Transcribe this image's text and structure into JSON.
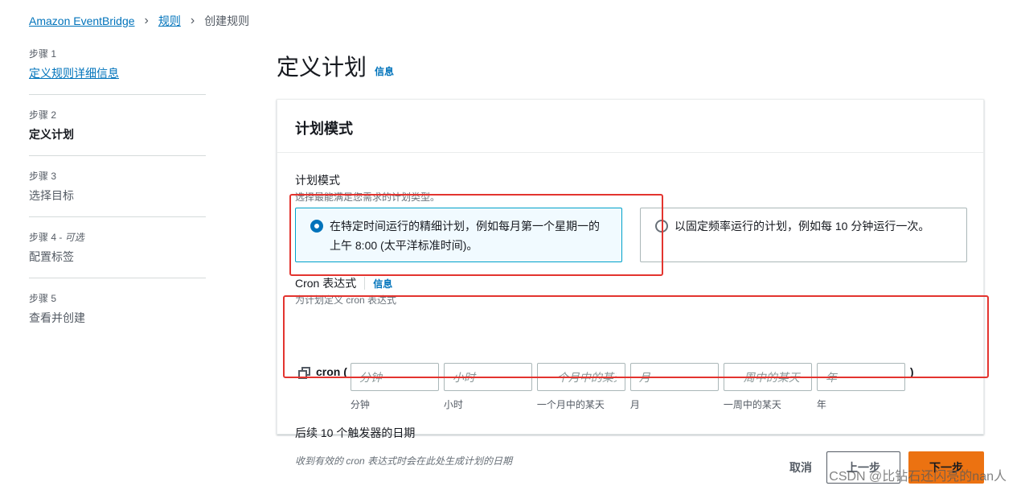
{
  "breadcrumb": {
    "items": [
      "Amazon EventBridge",
      "规则",
      "创建规则"
    ]
  },
  "steps": [
    {
      "label": "步骤 1",
      "optional": "",
      "title": "定义规则详细信息"
    },
    {
      "label": "步骤 2",
      "optional": "",
      "title": "定义计划"
    },
    {
      "label": "步骤 3",
      "optional": "",
      "title": "选择目标"
    },
    {
      "label": "步骤 4 - ",
      "optional": "可选",
      "title": "配置标签"
    },
    {
      "label": "步骤 5",
      "optional": "",
      "title": "查看并创建"
    }
  ],
  "page": {
    "title": "定义计划",
    "info": "信息"
  },
  "panel": {
    "header": "计划模式",
    "schedule_pattern": {
      "label": "计划模式",
      "description": "选择最能满足您需求的计划类型。",
      "options": [
        {
          "text": "在特定时间运行的精细计划，例如每月第一个星期一的上午 8:00 (太平洋标准时间)。",
          "selected": true
        },
        {
          "text": "以固定频率运行的计划，例如每 10 分钟运行一次。",
          "selected": false
        }
      ]
    },
    "cron": {
      "label": "Cron 表达式",
      "info": "信息",
      "description": "为计划定义 cron 表达式",
      "prefix": "cron (",
      "suffix": ")",
      "fields": [
        {
          "placeholder": "分钟",
          "sublabel": "分钟"
        },
        {
          "placeholder": "小时",
          "sublabel": "小时"
        },
        {
          "placeholder": "一个月中的某天",
          "sublabel": "一个月中的某天"
        },
        {
          "placeholder": "月",
          "sublabel": "月"
        },
        {
          "placeholder": "一周中的某天",
          "sublabel": "一周中的某天"
        },
        {
          "placeholder": "年",
          "sublabel": "年"
        }
      ]
    },
    "next_triggers": {
      "label": "后续 10 个触发器的日期",
      "hint": "收到有效的 cron 表达式时会在此处生成计划的日期"
    }
  },
  "actions": {
    "cancel": "取消",
    "previous": "上一步",
    "next": "下一步"
  },
  "watermark": "CSDN @比钻石还闪亮的nan人",
  "colors": {
    "link": "#0073bb",
    "primary_button": "#ec7211",
    "selected_card_bg": "#f1faff",
    "annotation_red": "#e3342f"
  }
}
